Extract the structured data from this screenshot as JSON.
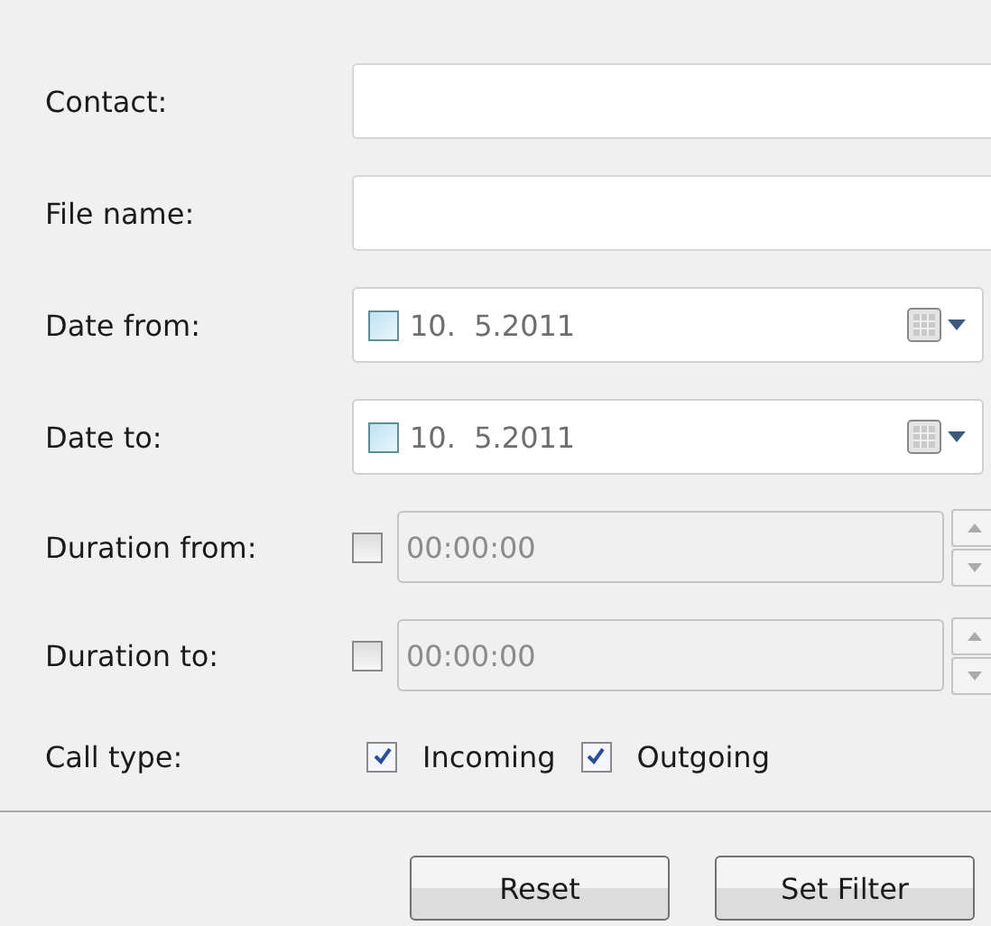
{
  "rows": [
    {
      "kind": "text",
      "label": "Contact:",
      "value": ""
    },
    {
      "kind": "text",
      "label": "File name:",
      "value": ""
    },
    {
      "kind": "date",
      "label": "Date from:",
      "checked": false,
      "value": "10.  5.2011"
    },
    {
      "kind": "date",
      "label": "Date to:",
      "checked": false,
      "value": "10.  5.2011"
    },
    {
      "kind": "duration",
      "label": "Duration from:",
      "checked": false,
      "disabled": true,
      "value": "00:00:00"
    },
    {
      "kind": "duration",
      "label": "Duration to:",
      "checked": false,
      "disabled": true,
      "value": "00:00:00"
    },
    {
      "kind": "checks",
      "label": "Call type:",
      "options": [
        {
          "label": "Incoming",
          "checked": true
        },
        {
          "label": "Outgoing",
          "checked": true
        }
      ]
    }
  ],
  "buttons": [
    "Reset",
    "Set Filter"
  ]
}
